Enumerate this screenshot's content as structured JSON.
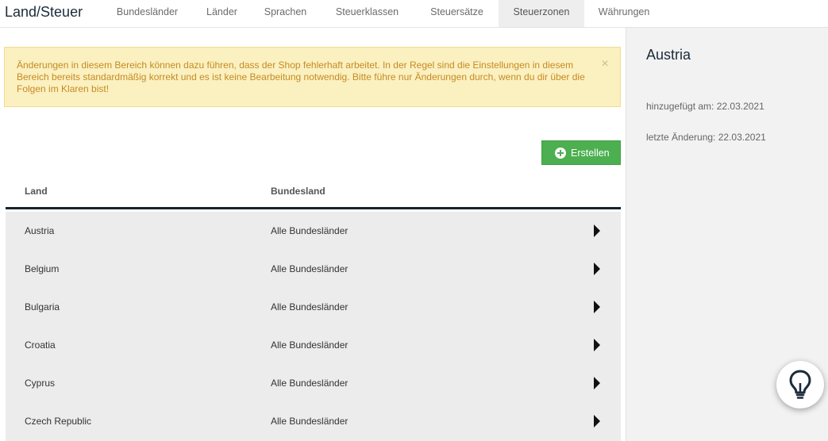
{
  "header": {
    "title": "Land/Steuer",
    "tabs": [
      {
        "label": "Bundesländer",
        "active": false
      },
      {
        "label": "Länder",
        "active": false
      },
      {
        "label": "Sprachen",
        "active": false
      },
      {
        "label": "Steuerklassen",
        "active": false
      },
      {
        "label": "Steuersätze",
        "active": false
      },
      {
        "label": "Steuerzonen",
        "active": true
      },
      {
        "label": "Währungen",
        "active": false
      }
    ]
  },
  "alert": {
    "text": "Änderungen in diesem Bereich können dazu führen, dass der Shop fehlerhaft arbeitet. In der Regel sind die Einstellungen in diesem Bereich bereits standardmäßig korrekt und es ist keine Bearbeitung notwendig. Bitte führe nur Änderungen durch, wenn du dir über die Folgen im Klaren bist!",
    "close_label": "×"
  },
  "toolbar": {
    "create_label": "Erstellen"
  },
  "table": {
    "columns": [
      "Land",
      "Bundesland"
    ],
    "rows": [
      {
        "land": "Austria",
        "bundesland": "Alle Bundesländer"
      },
      {
        "land": "Belgium",
        "bundesland": "Alle Bundesländer"
      },
      {
        "land": "Bulgaria",
        "bundesland": "Alle Bundesländer"
      },
      {
        "land": "Croatia",
        "bundesland": "Alle Bundesländer"
      },
      {
        "land": "Cyprus",
        "bundesland": "Alle Bundesländer"
      },
      {
        "land": "Czech Republic",
        "bundesland": "Alle Bundesländer"
      }
    ]
  },
  "detail": {
    "title": "Austria",
    "added": "hinzugefügt am: 22.03.2021",
    "modified": "letzte Änderung: 22.03.2021"
  },
  "colors": {
    "accent_green": "#4caf50",
    "alert_bg": "#fbf0c0",
    "alert_text": "#c58b22",
    "table_border": "#14232f"
  },
  "icons": {
    "create": "plus-circle-icon",
    "row_action": "caret-right-icon",
    "help": "lightbulb-icon"
  }
}
